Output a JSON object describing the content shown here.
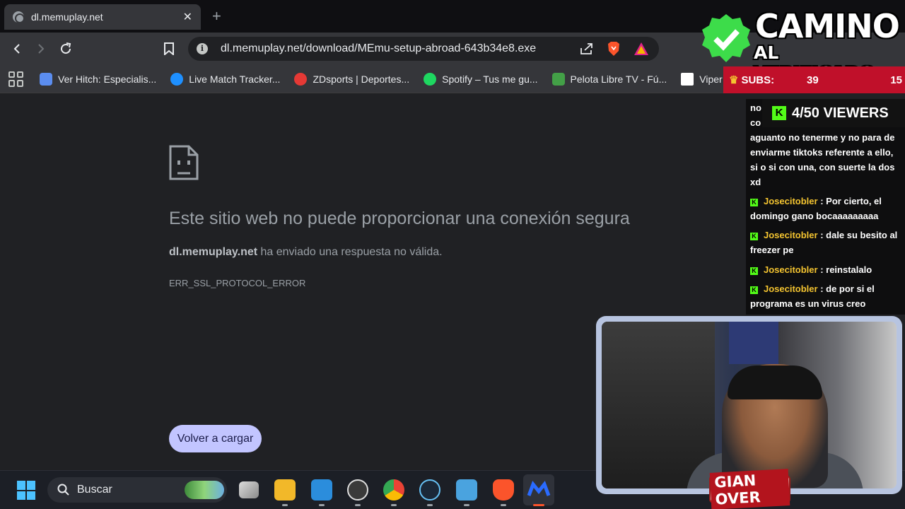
{
  "browser": {
    "tab_title": "dl.memuplay.net",
    "tab_close": "✕",
    "new_tab": "+",
    "url_host": "dl.memuplay.net",
    "url_path": "/download/MEmu-setup-abroad-643b34e8.exe",
    "info_glyph": "i"
  },
  "bookmarks": [
    {
      "label": "Ver Hitch: Especialis...",
      "color": "#5b8def"
    },
    {
      "label": "Live Match Tracker...",
      "color": "#1e90ff"
    },
    {
      "label": "ZDsports | Deportes...",
      "color": "#e53935"
    },
    {
      "label": "Spotify – Tus me gu...",
      "color": "#1ed760"
    },
    {
      "label": "Pelota Libre TV - Fú...",
      "color": "#43a047"
    },
    {
      "label": "Viper",
      "color": "#ffffff"
    }
  ],
  "error": {
    "title": "Este sitio web no puede proporcionar una conexión segura",
    "host": "dl.memuplay.net",
    "desc_rest": " ha enviado una respuesta no válida.",
    "code": "ERR_SSL_PROTOCOL_ERROR",
    "reload_label": "Volver a cargar"
  },
  "taskbar": {
    "search_label": "Buscar"
  },
  "overlay": {
    "title_line1": "CAMINO",
    "title_line2": "AL VERIFICADO",
    "subs_label": "SUBS:",
    "subs_value1": "39",
    "subs_value2": "15",
    "viewers_label": "4/50 VIEWERS",
    "kick_glyph": "K",
    "chat": [
      {
        "user": "",
        "text": "no"
      },
      {
        "user": "",
        "text": "co"
      },
      {
        "user": "",
        "text": "aguanto no tenerme y no para de enviarme tiktoks referente a ello, si o si con una, con suerte la dos xd"
      },
      {
        "user": "Josecitobler",
        "text": " : Por cierto, el domingo gano bocaaaaaaaaa"
      },
      {
        "user": "Josecitobler",
        "text": " : dale su besito al freezer pe"
      },
      {
        "user": "Josecitobler",
        "text": " : reinstalalo"
      },
      {
        "user": "Josecitobler",
        "text": " : de por si el programa es un virus creo"
      }
    ],
    "name_badge": "GIAN OVER"
  }
}
